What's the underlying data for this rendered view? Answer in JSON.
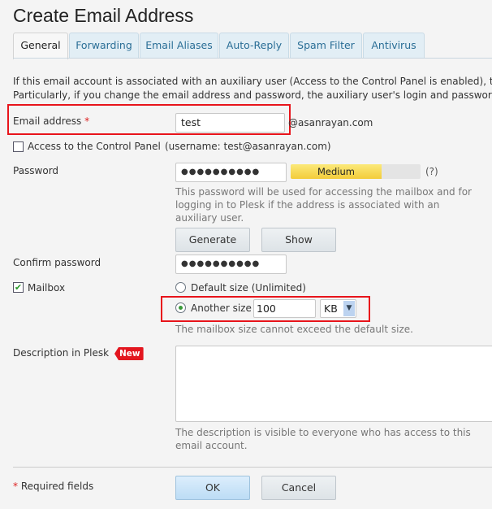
{
  "title": "Create Email Address",
  "tabs": [
    {
      "label": "General",
      "active": true
    },
    {
      "label": "Forwarding"
    },
    {
      "label": "Email Aliases"
    },
    {
      "label": "Auto-Reply"
    },
    {
      "label": "Spam Filter"
    },
    {
      "label": "Antivirus"
    }
  ],
  "intro": {
    "line1": "If this email account is associated with an auxiliary user (Access to the Control Panel is enabled), the",
    "line2": "Particularly, if you change the email address and password, the auxiliary user's login and password w"
  },
  "email": {
    "label": "Email address",
    "required_mark": "*",
    "value": "test",
    "domain": "@asanrayan.com"
  },
  "access": {
    "label": "Access to the Control Panel",
    "username_note": "(username: test@asanrayan.com)",
    "checked": false
  },
  "password": {
    "label": "Password",
    "value": "●●●●●●●●●●",
    "strength": "Medium",
    "strength_percent": 70,
    "help_link": "(?)",
    "help": "This password will be used for accessing the mailbox and for logging in to Plesk if the address is associated with an auxiliary user.",
    "generate_label": "Generate",
    "show_label": "Show"
  },
  "confirm": {
    "label": "Confirm password",
    "value": "●●●●●●●●●●"
  },
  "mailbox": {
    "label": "Mailbox",
    "checked": true,
    "default_option": "Default size (Unlimited)",
    "another_option": "Another size",
    "size_value": "100",
    "unit": "KB",
    "help": "The mailbox size cannot exceed the default size."
  },
  "description": {
    "label": "Description in Plesk",
    "badge": "New",
    "value": "",
    "help": "The description is visible to everyone who has access to this email account."
  },
  "footer": {
    "required_mark": "*",
    "required_label": "Required fields",
    "ok_label": "OK",
    "cancel_label": "Cancel"
  },
  "colors": {
    "highlight": "#e8141b",
    "accent": "#2a6e96",
    "meter": "#f7d84a"
  }
}
